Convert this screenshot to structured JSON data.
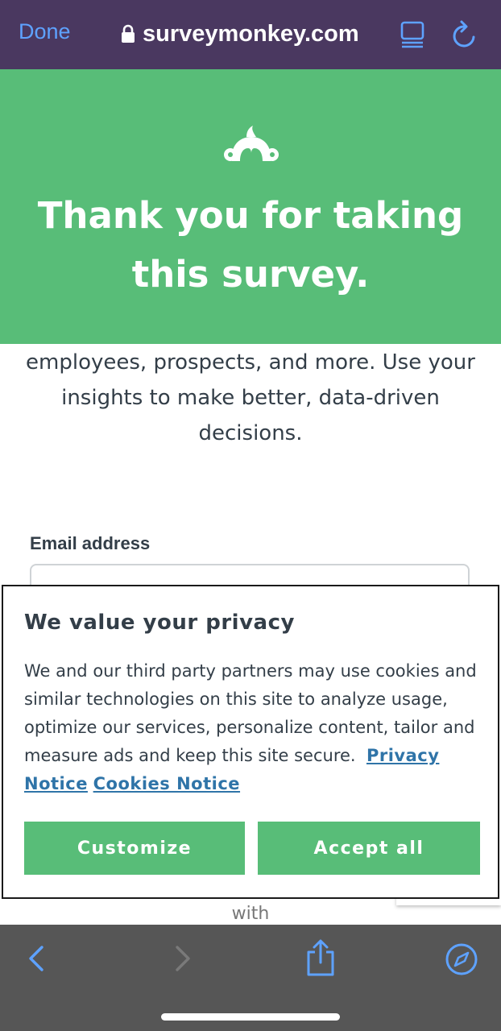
{
  "browser": {
    "done_label": "Done",
    "url": "surveymonkey.com"
  },
  "hero": {
    "title": "Thank you for taking this survey."
  },
  "content": {
    "body_text": "employees, prospects, and more. Use your insights to make better, data-driven decisions.",
    "email_label": "Email address",
    "email_value": "",
    "partial_text": "with"
  },
  "cookie": {
    "title": "We value your privacy",
    "text": "We and our third party partners may use cookies and similar technologies on this site to analyze usage, optimize our services, personalize content, tailor and measure ads and keep this site secure.",
    "privacy_link": "Privacy Notice",
    "cookies_link": "Cookies Notice",
    "customize_label": "Customize",
    "accept_label": "Accept all"
  },
  "colors": {
    "brand_green": "#58bd78",
    "link_blue": "#2f74a8",
    "safari_blue": "#5ea2ff",
    "topbar_purple": "#4a3860"
  },
  "icons": [
    "lock-icon",
    "reader-mode-icon",
    "reload-icon",
    "surveymonkey-logo-icon",
    "back-icon",
    "forward-icon",
    "share-icon",
    "compass-icon"
  ]
}
